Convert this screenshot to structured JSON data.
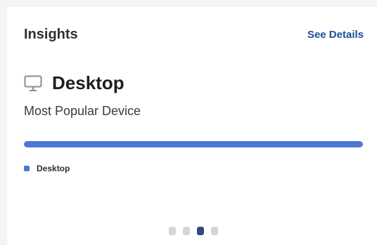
{
  "card": {
    "title": "Insights",
    "see_details_label": "See Details"
  },
  "insight": {
    "icon": "monitor-icon",
    "device": "Desktop",
    "subtitle": "Most Popular Device",
    "bar_percent": 100,
    "bar_color": "#4a78d4",
    "legend_label": "Desktop",
    "legend_color": "#4a78d4"
  },
  "pager": {
    "count": 4,
    "active_index": 2
  }
}
